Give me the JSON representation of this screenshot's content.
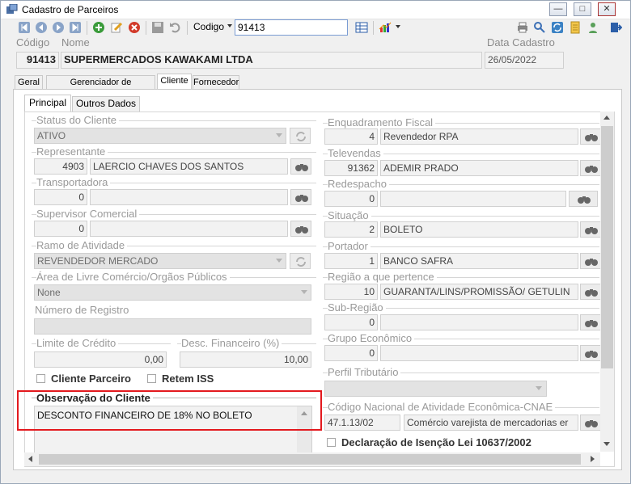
{
  "window": {
    "title": "Cadastro de Parceiros"
  },
  "toolbar": {
    "codigo_label": "Codigo",
    "codigo_value": "91413"
  },
  "header": {
    "codigo_label": "Código",
    "nome_label": "Nome",
    "data_label": "Data Cadastro",
    "codigo_value": "91413",
    "nome_value": "SUPERMERCADOS KAWAKAMI LTDA",
    "data_value": "26/05/2022"
  },
  "tabs": [
    "Geral",
    "Gerenciador de Documentos",
    "Cliente",
    "Fornecedor"
  ],
  "subtabs": [
    "Principal",
    "Outros Dados"
  ],
  "left": {
    "status": {
      "label": "Status do Cliente",
      "value": "ATIVO"
    },
    "representante": {
      "label": "Representante",
      "code": "4903",
      "name": "LAERCIO CHAVES DOS SANTOS"
    },
    "transportadora": {
      "label": "Transportadora",
      "code": "0",
      "name": ""
    },
    "supervisor": {
      "label": "Supervisor Comercial",
      "code": "0",
      "name": ""
    },
    "ramo": {
      "label": "Ramo de Atividade",
      "value": "REVENDEDOR MERCADO"
    },
    "area": {
      "label": "Área de Livre Comércio/Orgãos Públicos",
      "value": "None"
    },
    "numero_registro": {
      "label": "Número de Registro",
      "value": ""
    },
    "limite": {
      "label": "Limite de Crédito",
      "value": "0,00"
    },
    "desconto": {
      "label": "Desc. Financeiro (%)",
      "value": "10,00"
    },
    "cliente_parceiro": "Cliente Parceiro",
    "retem_iss": "Retem ISS",
    "observacao": {
      "label": "Observação do Cliente",
      "text": "DESCONTO FINANCEIRO DE 18% NO BOLETO"
    }
  },
  "right": {
    "enquadramento": {
      "label": "Enquadramento Fiscal",
      "code": "4",
      "name": "Revendedor RPA"
    },
    "televendas": {
      "label": "Televendas",
      "code": "91362",
      "name": "ADEMIR PRADO"
    },
    "redespacho": {
      "label": "Redespacho",
      "code": "0",
      "name": ""
    },
    "situacao": {
      "label": "Situação",
      "code": "2",
      "name": "BOLETO"
    },
    "portador": {
      "label": "Portador",
      "code": "1",
      "name": "BANCO SAFRA"
    },
    "regiao": {
      "label": "Região a que pertence",
      "code": "10",
      "name": "GUARANTA/LINS/PROMISSÃO/ GETULIN"
    },
    "subregiao": {
      "label": "Sub-Região",
      "code": "0",
      "name": ""
    },
    "grupo": {
      "label": "Grupo Econômico",
      "code": "0",
      "name": ""
    },
    "perfil": {
      "label": "Perfil Tributário",
      "value": ""
    },
    "cnae": {
      "label": "Código Nacional de Atividade Econômica-CNAE",
      "code": "47.1.13/02",
      "name": "Comércio varejista de mercadorias er"
    },
    "declaracao": "Declaração de Isenção Lei 10637/2002"
  }
}
